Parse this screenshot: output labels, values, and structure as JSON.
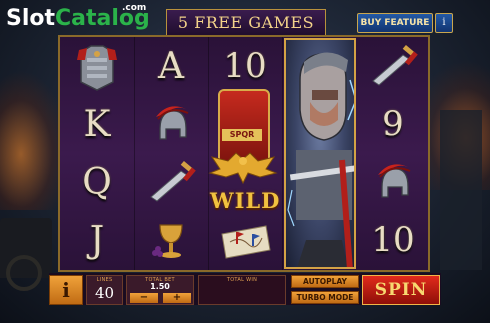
{
  "logo": {
    "slot": "Slot",
    "catalog": "Catalog",
    "com": ".com"
  },
  "banner": {
    "free_games": "5 FREE GAMES"
  },
  "header": {
    "buy_feature": "BUY FEATURE",
    "info": "i"
  },
  "reels": {
    "col1": [
      "armor-icon",
      "K",
      "Q",
      "J"
    ],
    "col2": [
      "A",
      "helmet-icon",
      "sword-icon",
      "goblet-icon"
    ],
    "col3": [
      "10",
      "wild-icon",
      "wild-icon",
      "map-icon"
    ],
    "col4": [
      "warrior-icon",
      "warrior-icon",
      "warrior-icon",
      "warrior-icon"
    ],
    "col5": [
      "sword-icon",
      "9",
      "helmet-icon",
      "10"
    ],
    "wild_label": "WILD",
    "wild_spqr": "SPQR"
  },
  "controls": {
    "info": "i",
    "lines_label": "LINES",
    "lines_value": "40",
    "total_bet_label": "TOTAL BET",
    "total_bet_value": "1.50",
    "minus": "−",
    "plus": "+",
    "total_win_label": "TOTAL WIN",
    "autoplay": "AUTOPLAY",
    "turbo": "TURBO MODE",
    "spin": "SPIN"
  }
}
